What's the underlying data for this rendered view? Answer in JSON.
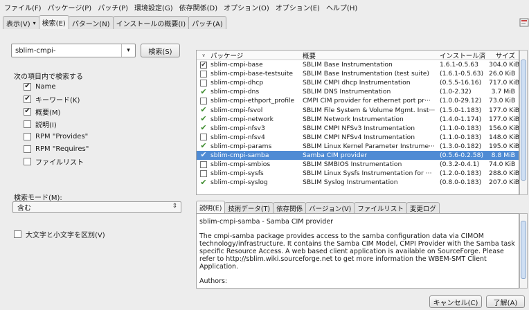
{
  "menubar": [
    "ファイル(F)",
    "パッケージ(P)",
    "パッチ(P)",
    "環境設定(G)",
    "依存関係(D)",
    "オプション(O)",
    "オプション(E)",
    "ヘルプ(H)"
  ],
  "toptabs": {
    "view": "表示(V)",
    "search": "検索(E)",
    "patterns": "パターン(N)",
    "install_summary": "インストールの概要(I)",
    "patches": "パッチ(A)"
  },
  "search": {
    "query": "sblim-cmpi-",
    "button": "検索(S)",
    "search_in_label": "次の項目内で検索する",
    "options": [
      {
        "label": "Name",
        "checked": true
      },
      {
        "label": "キーワード(K)",
        "checked": true
      },
      {
        "label": "概要(M)",
        "checked": true
      },
      {
        "label": "説明(I)",
        "checked": false
      },
      {
        "label": "RPM \"Provides\"",
        "checked": false
      },
      {
        "label": "RPM \"Requires\"",
        "checked": false
      },
      {
        "label": "ファイルリスト",
        "checked": false
      }
    ],
    "mode_label": "検索モード(M):",
    "mode_value": "含む",
    "case_label": "大文字と小文字を区別(V)"
  },
  "table": {
    "headers": {
      "package": "パッケージ",
      "summary": "概要",
      "installed": "インストール済",
      "size": "サイズ"
    },
    "rows": [
      {
        "status": "installed",
        "name": "sblim-cmpi-base",
        "summary": "SBLIM Base Instrumentation",
        "version": "1.6.1-0.5.63",
        "size": "304.0 KiB"
      },
      {
        "status": "none",
        "name": "sblim-cmpi-base-testsuite",
        "summary": "SBLIM Base Instrumentation (test suite)",
        "version": "(1.6.1-0.5.63)",
        "size": "26.0 KiB"
      },
      {
        "status": "none",
        "name": "sblim-cmpi-dhcp",
        "summary": "SBLIM CMPI dhcp Instrumentation",
        "version": "(0.5.5-16.16)",
        "size": "717.0 KiB"
      },
      {
        "status": "check",
        "name": "sblim-cmpi-dns",
        "summary": "SBLIM DNS Instrumentation",
        "version": "(1.0-2.32)",
        "size": "3.7 MiB"
      },
      {
        "status": "none",
        "name": "sblim-cmpi-ethport_profile",
        "summary": "CMPI CIM provider for ethernet port pr···",
        "version": "(1.0.0-29.12)",
        "size": "73.0 KiB"
      },
      {
        "status": "check",
        "name": "sblim-cmpi-fsvol",
        "summary": "SBLIM File System & Volume Mgmt. Inst···",
        "version": "(1.5.0-1.183)",
        "size": "177.0 KiB"
      },
      {
        "status": "check",
        "name": "sblim-cmpi-network",
        "summary": "SBLIM Network Instrumentation",
        "version": "(1.4.0-1.174)",
        "size": "177.0 KiB"
      },
      {
        "status": "check",
        "name": "sblim-cmpi-nfsv3",
        "summary": "SBLIM CMPI NFSv3 Instrumentation",
        "version": "(1.1.0-0.183)",
        "size": "156.0 KiB"
      },
      {
        "status": "none",
        "name": "sblim-cmpi-nfsv4",
        "summary": "SBLIM CMPI NFSv4 Instrumentation",
        "version": "(1.1.0-0.183)",
        "size": "148.0 KiB"
      },
      {
        "status": "check",
        "name": "sblim-cmpi-params",
        "summary": "SBLIM Linux Kernel Parameter Instrume···",
        "version": "(1.3.0-0.182)",
        "size": "195.0 KiB"
      },
      {
        "status": "check",
        "name": "sblim-cmpi-samba",
        "summary": "Samba CIM provider",
        "version": "(0.5.6-0.2.58)",
        "size": "8.8 MiB",
        "selected": true
      },
      {
        "status": "none",
        "name": "sblim-cmpi-smbios",
        "summary": "SBLIM SMBIOS Instrumentation",
        "version": "(0.3.2-0.4.1)",
        "size": "74.0 KiB"
      },
      {
        "status": "none",
        "name": "sblim-cmpi-sysfs",
        "summary": "SBLIM Linux Sysfs Instrumentation for ···",
        "version": "(1.2.0-0.183)",
        "size": "288.0 KiB"
      },
      {
        "status": "check",
        "name": "sblim-cmpi-syslog",
        "summary": "SBLIM Syslog Instrumentation",
        "version": "(0.8.0-0.183)",
        "size": "207.0 KiB"
      }
    ]
  },
  "detail_tabs": [
    "説明(E)",
    "技術データ(T)",
    "依存関係",
    "バージョン(V)",
    "ファイルリスト",
    "変更ログ"
  ],
  "description": {
    "title": "sblim-cmpi-samba - Samba CIM provider",
    "body": "The cmpi-samba package provides access to the samba configuration data via CIMOM technology/infrastructure. It contains the Samba CIM Model, CMPI Provider with the Samba task specific Resource Access. A web based client application is available on SourceForge. Please refer to http://sblim.wiki.sourceforge.net to get more information the WBEM-SMT Client Application.",
    "authors": "Authors:"
  },
  "buttons": {
    "cancel": "キャンセル(C)",
    "apply": "了解(A)"
  },
  "colors": {
    "selection": "#4f8bd4",
    "check": "#3a8a2a",
    "background": "#ededed"
  }
}
